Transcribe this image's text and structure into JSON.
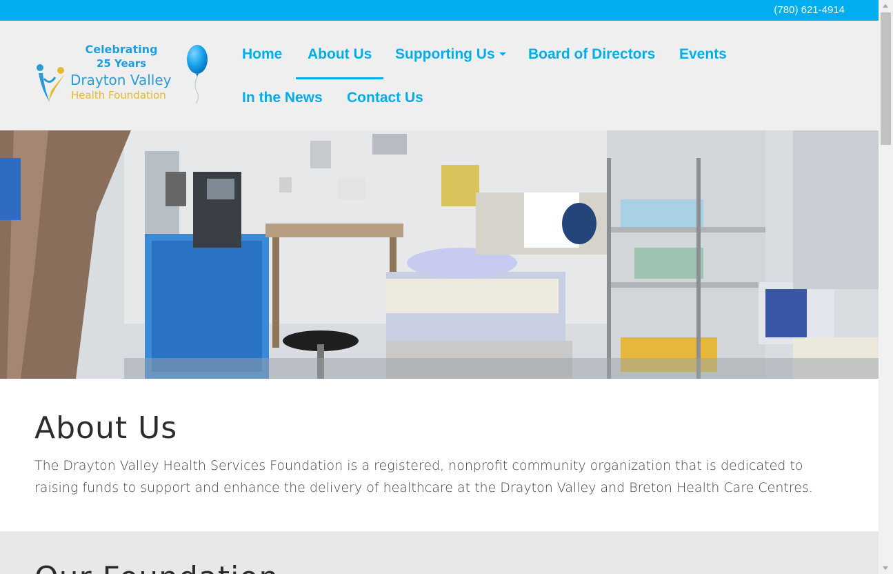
{
  "topbar": {
    "phone": "(780) 621-4914"
  },
  "logo": {
    "celebrating": "Celebrating",
    "years": "25 Years",
    "name_line1": "Drayton Valley",
    "name_line2": "Health Foundation"
  },
  "nav": {
    "items": [
      {
        "label": "Home"
      },
      {
        "label": "About Us",
        "active": true
      },
      {
        "label": "Supporting Us",
        "dropdown": true
      },
      {
        "label": "Board of Directors"
      },
      {
        "label": "Events"
      },
      {
        "label": "In the News"
      },
      {
        "label": "Contact Us"
      }
    ]
  },
  "about": {
    "heading": "About Us",
    "body": "The Drayton Valley Health Services Foundation is a registered, nonprofit community organization that is dedicated to raising funds to support and enhance the delivery of healthcare at the Drayton Valley and Breton Health Care Centres."
  },
  "next_section": {
    "heading": "Our Foundation"
  },
  "colors": {
    "accent": "#00aeef",
    "header_bg": "#efefef",
    "logo_gold": "#e4b92c",
    "logo_blue": "#2a9ad6",
    "section_grey": "#e8e8e8"
  },
  "icons": {
    "dropdown": "caret-down-icon",
    "balloon": "balloon-icon",
    "figures": "people-figures-icon"
  }
}
